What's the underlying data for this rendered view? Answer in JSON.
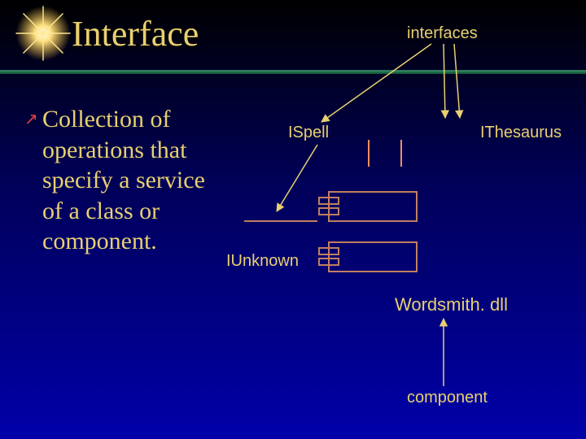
{
  "title": "Interface",
  "bullet": "Collection of operations that specify a service of a class or component.",
  "labels": {
    "interfaces": "interfaces",
    "ispell": "ISpell",
    "ithesaurus": "IThesaurus",
    "iunknown": "IUnknown",
    "dll": "Wordsmith. dll",
    "component": "component"
  }
}
